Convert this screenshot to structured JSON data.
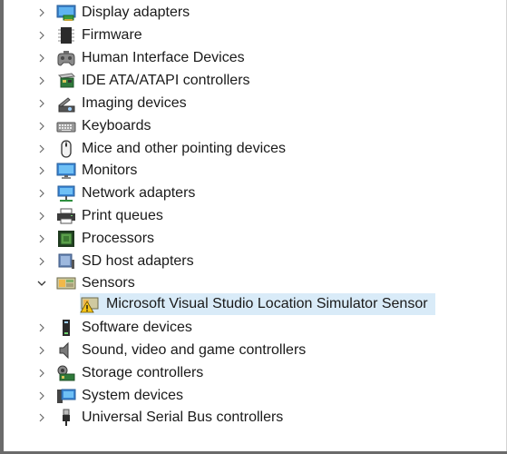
{
  "device_tree": {
    "items": [
      {
        "label": "Display adapters",
        "icon": "display-adapter-icon",
        "expanded": false
      },
      {
        "label": "Firmware",
        "icon": "firmware-icon",
        "expanded": false
      },
      {
        "label": "Human Interface Devices",
        "icon": "hid-icon",
        "expanded": false
      },
      {
        "label": "IDE ATA/ATAPI controllers",
        "icon": "ide-controller-icon",
        "expanded": false
      },
      {
        "label": "Imaging devices",
        "icon": "imaging-device-icon",
        "expanded": false
      },
      {
        "label": "Keyboards",
        "icon": "keyboard-icon",
        "expanded": false
      },
      {
        "label": "Mice and other pointing devices",
        "icon": "mouse-icon",
        "expanded": false
      },
      {
        "label": "Monitors",
        "icon": "monitor-icon",
        "expanded": false
      },
      {
        "label": "Network adapters",
        "icon": "network-adapter-icon",
        "expanded": false
      },
      {
        "label": "Print queues",
        "icon": "printer-icon",
        "expanded": false
      },
      {
        "label": "Processors",
        "icon": "processor-icon",
        "expanded": false
      },
      {
        "label": "SD host adapters",
        "icon": "sd-host-icon",
        "expanded": false
      },
      {
        "label": "Sensors",
        "icon": "sensor-icon",
        "expanded": true,
        "children": [
          {
            "label": "Microsoft Visual Studio Location Simulator Sensor",
            "icon": "warning-sensor-icon",
            "selected": true
          }
        ]
      },
      {
        "label": "Software devices",
        "icon": "software-device-icon",
        "expanded": false
      },
      {
        "label": "Sound, video and game controllers",
        "icon": "speaker-icon",
        "expanded": false
      },
      {
        "label": "Storage controllers",
        "icon": "storage-controller-icon",
        "expanded": false
      },
      {
        "label": "System devices",
        "icon": "system-device-icon",
        "expanded": false
      },
      {
        "label": "Universal Serial Bus controllers",
        "icon": "usb-icon",
        "expanded": false
      }
    ]
  },
  "colors": {
    "selection": "#d9ebf8",
    "chevron": "#6b6b6b",
    "text": "#1a1a1a"
  }
}
